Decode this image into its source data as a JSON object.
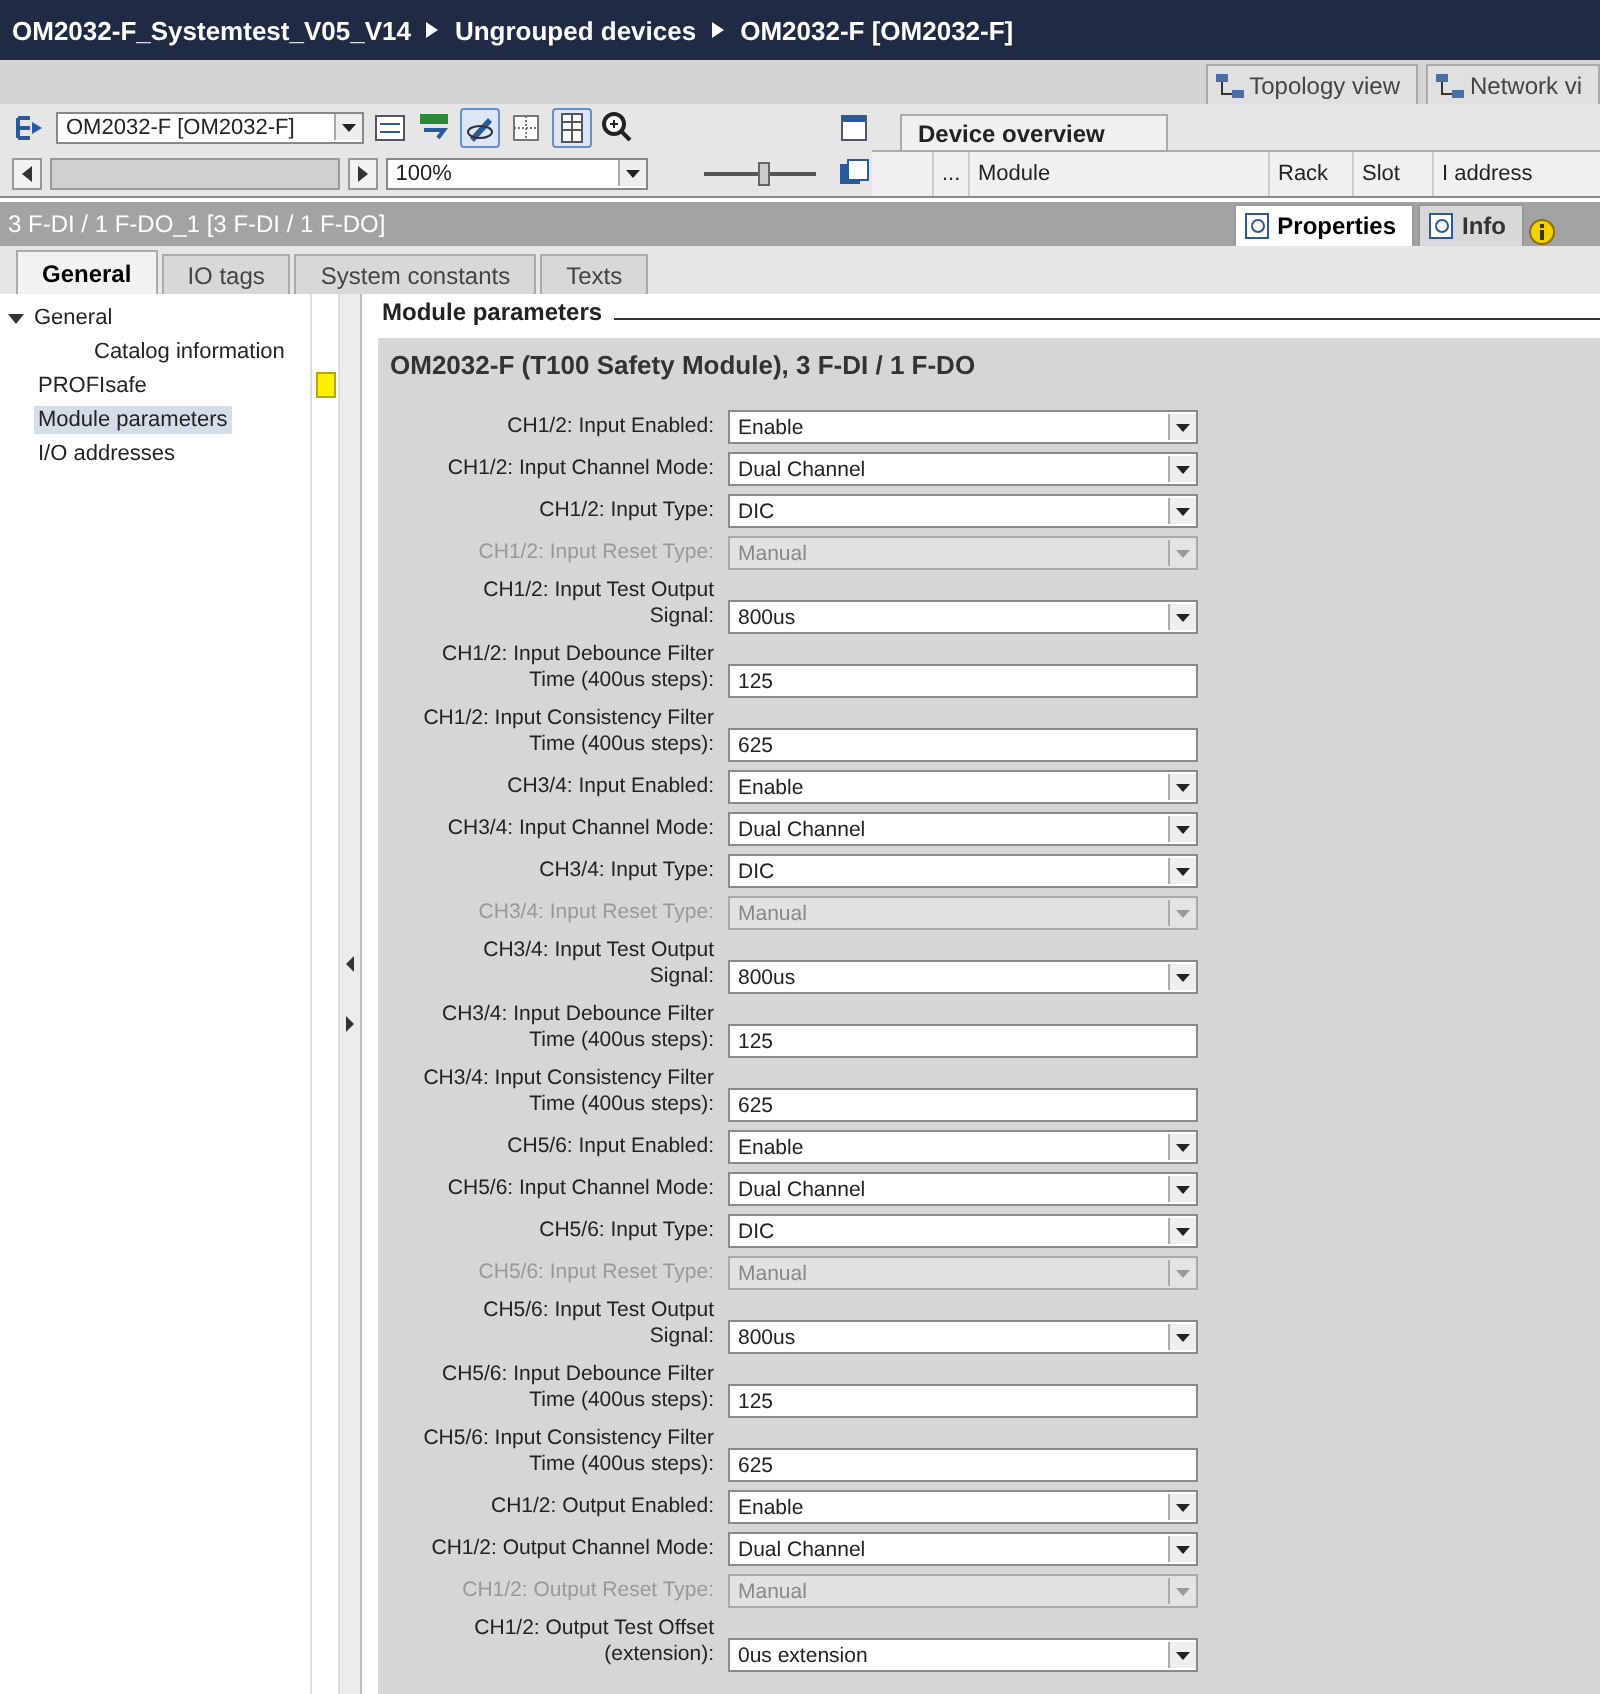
{
  "breadcrumb": [
    "OM2032-F_Systemtest_V05_V14",
    "Ungrouped devices",
    "OM2032-F [OM2032-F]"
  ],
  "view_tabs": [
    {
      "label": "Topology view",
      "selected": false
    },
    {
      "label": "Network vi",
      "selected": false
    }
  ],
  "device_toolbar": {
    "device_select": "OM2032-F [OM2032-F]",
    "zoom": "100%",
    "zoom_slider": {
      "level": 0.5
    }
  },
  "device_overview": {
    "title": "Device overview",
    "columns": [
      "...",
      "Module",
      "Rack",
      "Slot",
      "I address"
    ]
  },
  "inspector": {
    "title": "3 F-DI / 1 F-DO_1 [3 F-DI / 1 F-DO]",
    "tabs": [
      {
        "label": "Properties",
        "selected": true
      },
      {
        "label": "Info",
        "selected": false
      }
    ]
  },
  "tabs": [
    {
      "label": "General",
      "selected": true
    },
    {
      "label": "IO tags",
      "selected": false
    },
    {
      "label": "System constants",
      "selected": false
    },
    {
      "label": "Texts",
      "selected": false
    }
  ],
  "nav": [
    {
      "label": "General",
      "expanded": true,
      "selected": false,
      "marker": false,
      "children": [
        {
          "label": "Catalog information",
          "selected": false,
          "marker": false
        }
      ]
    },
    {
      "label": "PROFIsafe",
      "selected": false,
      "marker": true
    },
    {
      "label": "Module parameters",
      "selected": true,
      "marker": false
    },
    {
      "label": "I/O addresses",
      "selected": false,
      "marker": false
    }
  ],
  "section_title": "Module parameters",
  "module_title": "OM2032-F (T100 Safety Module), 3 F-DI / 1 F-DO",
  "fields": [
    {
      "label": "CH1/2: Input Enabled:",
      "value": "Enable",
      "kind": "dropdown",
      "disabled": false
    },
    {
      "label": "CH1/2: Input Channel Mode:",
      "value": "Dual Channel",
      "kind": "dropdown",
      "disabled": false
    },
    {
      "label": "CH1/2: Input Type:",
      "value": "DIC",
      "kind": "dropdown",
      "disabled": false
    },
    {
      "label": "CH1/2: Input Reset Type:",
      "value": "Manual",
      "kind": "dropdown",
      "disabled": true
    },
    {
      "label": "CH1/2: Input Test Output\nSignal:",
      "value": "800us",
      "kind": "dropdown",
      "disabled": false
    },
    {
      "label": "CH1/2: Input Debounce Filter\nTime (400us steps):",
      "value": "125",
      "kind": "text",
      "disabled": false
    },
    {
      "label": "CH1/2: Input Consistency Filter\nTime (400us steps):",
      "value": "625",
      "kind": "text",
      "disabled": false
    },
    {
      "label": "CH3/4: Input Enabled:",
      "value": "Enable",
      "kind": "dropdown",
      "disabled": false
    },
    {
      "label": "CH3/4: Input Channel Mode:",
      "value": "Dual Channel",
      "kind": "dropdown",
      "disabled": false
    },
    {
      "label": "CH3/4: Input Type:",
      "value": "DIC",
      "kind": "dropdown",
      "disabled": false
    },
    {
      "label": "CH3/4: Input Reset Type:",
      "value": "Manual",
      "kind": "dropdown",
      "disabled": true
    },
    {
      "label": "CH3/4: Input Test Output\nSignal:",
      "value": "800us",
      "kind": "dropdown",
      "disabled": false
    },
    {
      "label": "CH3/4: Input Debounce Filter\nTime (400us steps):",
      "value": "125",
      "kind": "text",
      "disabled": false
    },
    {
      "label": "CH3/4: Input Consistency Filter\nTime (400us steps):",
      "value": "625",
      "kind": "text",
      "disabled": false
    },
    {
      "label": "CH5/6: Input Enabled:",
      "value": "Enable",
      "kind": "dropdown",
      "disabled": false
    },
    {
      "label": "CH5/6: Input Channel Mode:",
      "value": "Dual Channel",
      "kind": "dropdown",
      "disabled": false
    },
    {
      "label": "CH5/6: Input Type:",
      "value": "DIC",
      "kind": "dropdown",
      "disabled": false
    },
    {
      "label": "CH5/6: Input Reset Type:",
      "value": "Manual",
      "kind": "dropdown",
      "disabled": true
    },
    {
      "label": "CH5/6: Input Test Output\nSignal:",
      "value": "800us",
      "kind": "dropdown",
      "disabled": false
    },
    {
      "label": "CH5/6: Input Debounce Filter\nTime (400us steps):",
      "value": "125",
      "kind": "text",
      "disabled": false
    },
    {
      "label": "CH5/6: Input Consistency Filter\nTime (400us steps):",
      "value": "625",
      "kind": "text",
      "disabled": false
    },
    {
      "label": "CH1/2: Output Enabled:",
      "value": "Enable",
      "kind": "dropdown",
      "disabled": false
    },
    {
      "label": "CH1/2: Output Channel Mode:",
      "value": "Dual Channel",
      "kind": "dropdown",
      "disabled": false
    },
    {
      "label": "CH1/2: Output Reset Type:",
      "value": "Manual",
      "kind": "dropdown",
      "disabled": true
    },
    {
      "label": "CH1/2: Output Test Offset\n(extension):",
      "value": "0us extension",
      "kind": "dropdown",
      "disabled": false
    }
  ]
}
